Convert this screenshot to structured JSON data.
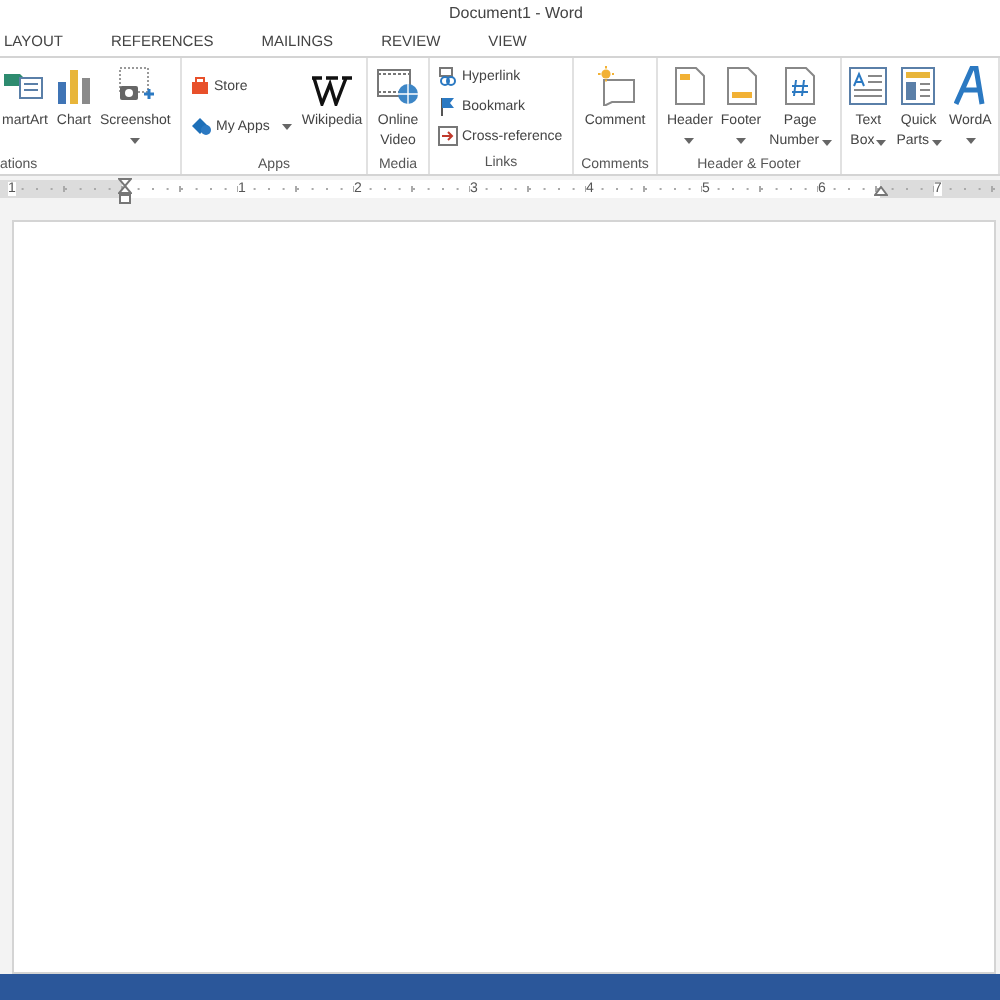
{
  "window": {
    "title": "Document1 - Word"
  },
  "tabs": [
    {
      "label": "LAYOUT",
      "selected": false
    },
    {
      "label": "REFERENCES",
      "selected": false
    },
    {
      "label": "MAILINGS",
      "selected": false
    },
    {
      "label": "REVIEW",
      "selected": false
    },
    {
      "label": "VIEW",
      "selected": false
    }
  ],
  "ribbon_groups": [
    {
      "label": "ations",
      "commands": [
        {
          "kind": "large",
          "lines": [
            "martArt"
          ],
          "dropdown": false
        },
        {
          "kind": "large",
          "lines": [
            "Chart"
          ],
          "dropdown": false
        },
        {
          "kind": "large",
          "lines": [
            "Screenshot"
          ],
          "dropdown": true
        }
      ]
    },
    {
      "label": "Apps",
      "commands": [
        {
          "kind": "small",
          "label": "Store",
          "dropdown": false
        },
        {
          "kind": "small",
          "label": "My Apps",
          "dropdown": true
        },
        {
          "kind": "large",
          "lines": [
            "Wikipedia"
          ],
          "dropdown": false
        }
      ]
    },
    {
      "label": "Media",
      "commands": [
        {
          "kind": "large",
          "lines": [
            "Online",
            "Video"
          ],
          "dropdown": false
        }
      ]
    },
    {
      "label": "Links",
      "commands": [
        {
          "kind": "small",
          "label": "Hyperlink",
          "dropdown": false
        },
        {
          "kind": "small",
          "label": "Bookmark",
          "dropdown": false
        },
        {
          "kind": "small",
          "label": "Cross-reference",
          "dropdown": false
        }
      ]
    },
    {
      "label": "Comments",
      "commands": [
        {
          "kind": "large",
          "lines": [
            "Comment"
          ],
          "dropdown": false
        }
      ]
    },
    {
      "label": "Header & Footer",
      "commands": [
        {
          "kind": "large",
          "lines": [
            "Header"
          ],
          "dropdown": true
        },
        {
          "kind": "large",
          "lines": [
            "Footer"
          ],
          "dropdown": true
        },
        {
          "kind": "large",
          "lines": [
            "Page",
            "Number"
          ],
          "dropdown": true
        }
      ]
    },
    {
      "commands": [
        {
          "kind": "large",
          "lines": [
            "Text",
            "Box"
          ],
          "dropdown": true
        },
        {
          "kind": "large",
          "lines": [
            "Quick",
            "Parts"
          ],
          "dropdown": true
        },
        {
          "kind": "large",
          "lines": [
            "WordA"
          ],
          "dropdown": true
        }
      ]
    }
  ],
  "ruler": {
    "labels": [
      "1",
      "1",
      "2",
      "3",
      "4",
      "5",
      "6",
      "7"
    ]
  }
}
